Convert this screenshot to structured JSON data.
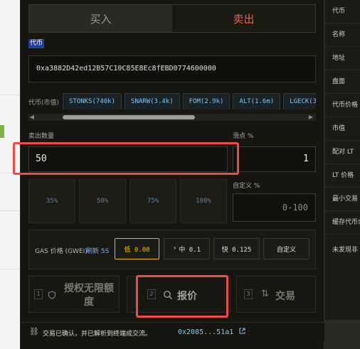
{
  "tabs": {
    "buy": "买入",
    "sell": "卖出"
  },
  "token_label": "代币",
  "token_address": "0xa3882D42ed12B57C10C85E8Ec8fEBD0774600000",
  "market_cap_label": "代币(市值)",
  "token_chips": [
    "STONKS(740k)",
    "SNARW(3.4k)",
    "FOM(2.9k)",
    "ALT(1.6m)",
    "LGECK(3"
  ],
  "scroll_left": "◀",
  "scroll_right": "▶",
  "sell_amount_label": "卖出数量",
  "sell_amount_value": "50",
  "slippage_label": "滑点 %",
  "slippage_value": "1",
  "percent_buttons": [
    "35%",
    "50%",
    "75%",
    "100%"
  ],
  "custom_label": "自定义 %",
  "custom_placeholder": "0-100",
  "gas": {
    "label": "GAS 价格 (GWEI)",
    "refresh": "刷新 5S",
    "low": "低 0.08",
    "medium": "中 0.1",
    "fast": "快 0.125",
    "custom": "自定义"
  },
  "steps": [
    {
      "num": "1",
      "label": "授权无限额\n度"
    },
    {
      "num": "2",
      "label": "报价"
    },
    {
      "num": "3",
      "label": "交易"
    }
  ],
  "footer": {
    "message": "交易已确认，并已解析到终端成交流。",
    "tx": "0x2085...51a1"
  },
  "side_labels": [
    "代币",
    "名称",
    "地址",
    "盘面",
    "代币价格",
    "市值",
    "配对 LT",
    "LT 价格",
    "最小交易",
    "缓存代币余",
    "未发现非"
  ],
  "colors": {
    "accent": "#f5c200",
    "sell": "#ff5a4a",
    "link": "#7fc7ff",
    "highlight": "#ef4a4a"
  }
}
